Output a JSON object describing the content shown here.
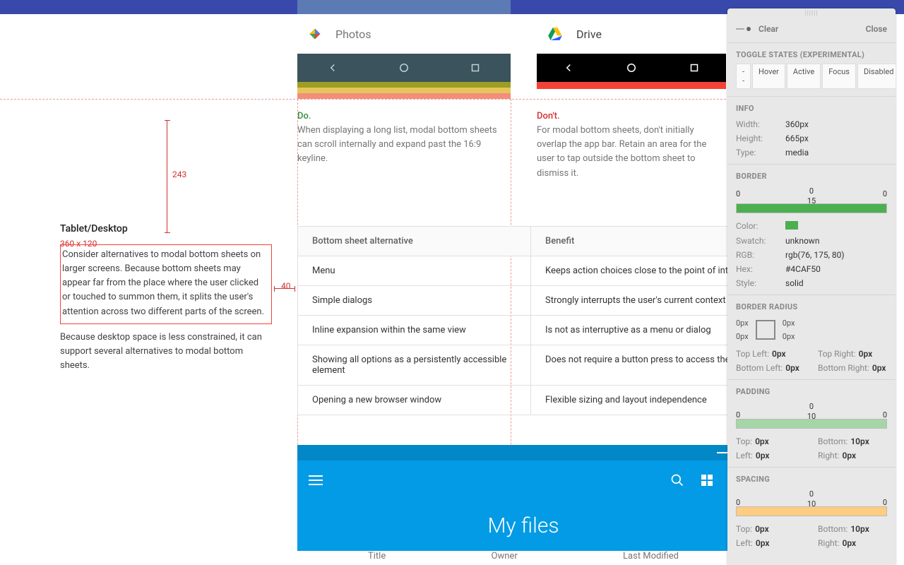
{
  "topbar": {},
  "phones": {
    "photos_label": "Photos",
    "drive_label": "Drive"
  },
  "captions": {
    "do": "Do.",
    "do_text": "When displaying a long list, modal bottom sheets can scroll internally and expand past the 16:9 keyline.",
    "dont": "Don't.",
    "dont_text": "For modal bottom sheets, don't initially overlap the app bar. Retain an area for the user to tap outside the bottom sheet to dismiss it."
  },
  "left": {
    "head": "Tablet/Desktop",
    "dim": "360 x 120",
    "p1": "Consider alternatives to modal bottom sheets on larger screens. Because bottom sheets may appear far from the place where the user clicked or touched to summon them, it splits the user's attention across two different parts of the screen.",
    "p2": "Because desktop space is less constrained, it can support several alternatives to modal bottom sheets."
  },
  "measures": {
    "v": "243",
    "h": "40"
  },
  "table": {
    "h1": "Bottom sheet alternative",
    "h2": "Benefit",
    "rows": [
      {
        "a": "Menu",
        "b": "Keeps action choices close to the point of interaction"
      },
      {
        "a": "Simple dialogs",
        "b": "Strongly interrupts the user's current context"
      },
      {
        "a": "Inline expansion within the same view",
        "b": "Is not as interruptive as a menu or dialog"
      },
      {
        "a": "Showing all options as a persistently accessible element",
        "b": "Does not require a button press to access them"
      },
      {
        "a": "Opening a new browser window",
        "b": "Flexible sizing and layout independence"
      }
    ]
  },
  "tablet": {
    "title": "My files",
    "th1": "Title",
    "th2": "Owner",
    "th3": "Last Modified"
  },
  "panel": {
    "clear": "Clear",
    "close": "Close",
    "toggle_head": "TOGGLE STATES (EXPERIMENTAL)",
    "states": [
      "--",
      "Hover",
      "Active",
      "Focus",
      "Disabled"
    ],
    "info_head": "INFO",
    "info": {
      "width_k": "Width:",
      "width_v": "360px",
      "height_k": "Height:",
      "height_v": "665px",
      "type_k": "Type:",
      "type_v": "media"
    },
    "border_head": "BORDER",
    "border_vals": {
      "tl": "0",
      "t": "0",
      "tr": "0",
      "c": "15"
    },
    "border": {
      "color_k": "Color:",
      "swatch": "#4CAF50",
      "swatch_k": "Swatch:",
      "swatch_v": "unknown",
      "rgb_k": "RGB:",
      "rgb_v": "rgb(76, 175, 80)",
      "hex_k": "Hex:",
      "hex_v": "#4CAF50",
      "style_k": "Style:",
      "style_v": "solid"
    },
    "radius_head": "BORDER RADIUS",
    "radius": {
      "tl": "0px",
      "tr": "0px",
      "bl": "0px",
      "br": "0px",
      "tl_k": "Top Left:",
      "tr_k": "Top Right:",
      "bl_k": "Bottom Left:",
      "br_k": "Bottom Right:",
      "tl_v": "0px",
      "tr_v": "0px",
      "bl_v": "0px",
      "br_v": "0px"
    },
    "padding_head": "PADDING",
    "padding_vals": {
      "t": "0",
      "l": "0",
      "r": "0",
      "c": "10"
    },
    "padding": {
      "top_k": "Top:",
      "top_v": "0px",
      "bottom_k": "Bottom:",
      "bottom_v": "10px",
      "left_k": "Left:",
      "left_v": "0px",
      "right_k": "Right:",
      "right_v": "0px"
    },
    "spacing_head": "SPACING",
    "spacing_vals": {
      "t": "0",
      "l": "0",
      "r": "0",
      "c": "10"
    },
    "spacing": {
      "top_k": "Top:",
      "top_v": "0px",
      "bottom_k": "Bottom:",
      "bottom_v": "10px",
      "left_k": "Left:",
      "left_v": "0px",
      "right_k": "Right:",
      "right_v": "0px"
    }
  }
}
